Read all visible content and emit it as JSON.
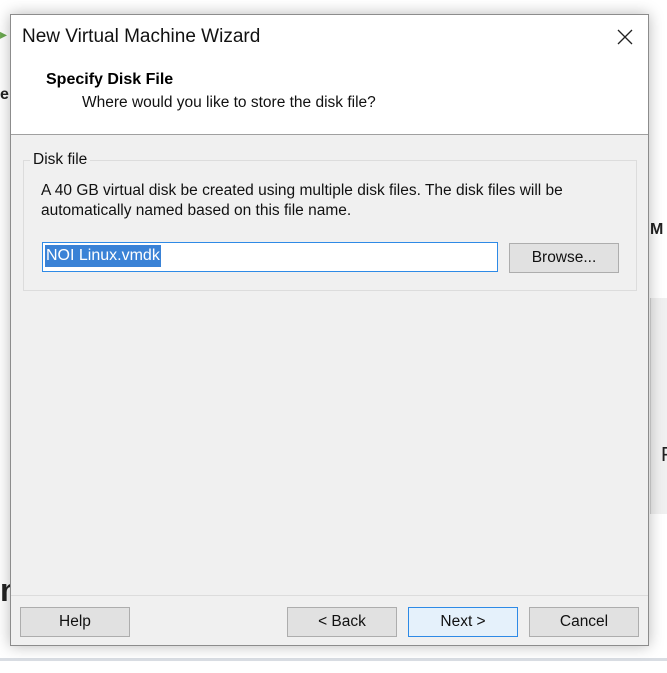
{
  "background": {
    "left_fragment": "e",
    "left_arrow_glyph": "▸",
    "left_bottom_fragment": "n",
    "right_top_fragment": "M",
    "right_mid_fragment": "F"
  },
  "dialog": {
    "title": "New Virtual Machine Wizard",
    "close_icon": "close-icon",
    "header": {
      "title": "Specify Disk File",
      "subtitle": "Where would you like to store the disk file?"
    },
    "disk_file_group": {
      "legend": "Disk file",
      "description": "A 40 GB virtual disk be created using multiple disk files. The disk files will be automatically named based on this file name.",
      "file_name_value": "NOI Linux.vmdk",
      "browse_label": "Browse..."
    },
    "footer": {
      "help_label": "Help",
      "back_label": "< Back",
      "next_label": "Next >",
      "cancel_label": "Cancel"
    }
  },
  "colors": {
    "accent": "#2e8ae6",
    "selection": "#3a82d6",
    "dialog_bg": "#f0f0f0",
    "button_bg": "#e1e1e1"
  }
}
